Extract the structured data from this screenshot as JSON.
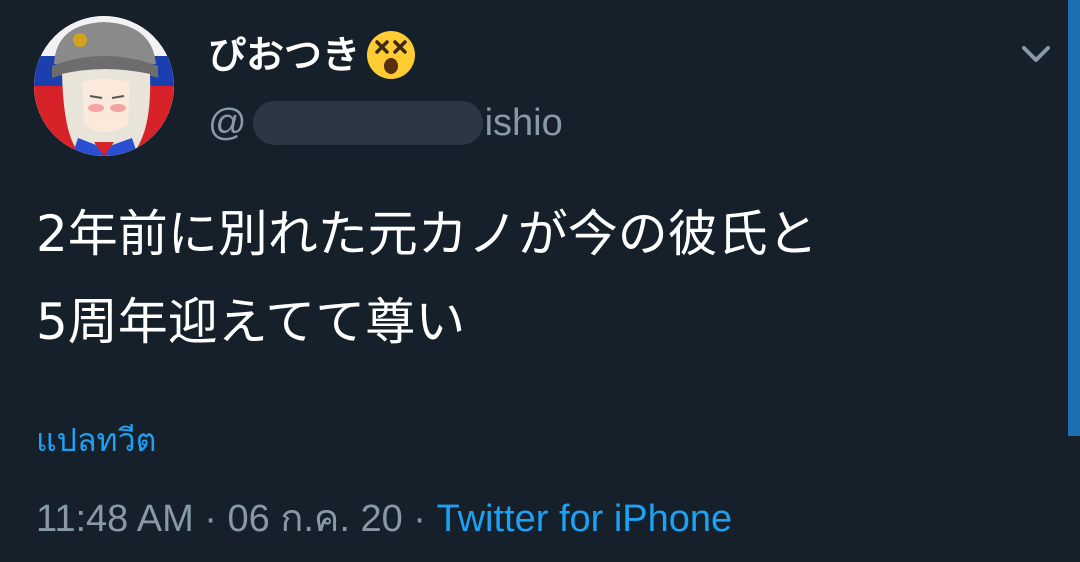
{
  "user": {
    "display_name": "ぴおつき",
    "name_emoji": "dizzy-face-emoji",
    "handle_prefix": "@",
    "handle_suffix": "ishio"
  },
  "tweet": {
    "text_line1": "2年前に別れた元カノが今の彼氏と",
    "text_line2": "5周年迎えてて尊い",
    "translate_label": "แปลทวีต",
    "time": "11:48 AM",
    "separator": "·",
    "date": "06 ก.ค. 20",
    "source": "Twitter for iPhone"
  },
  "icons": {
    "menu": "chevron-down-icon"
  },
  "colors": {
    "background": "#15202b",
    "accent": "#1da1f2",
    "secondary_text": "#8899a6",
    "primary_text": "#ffffff"
  }
}
